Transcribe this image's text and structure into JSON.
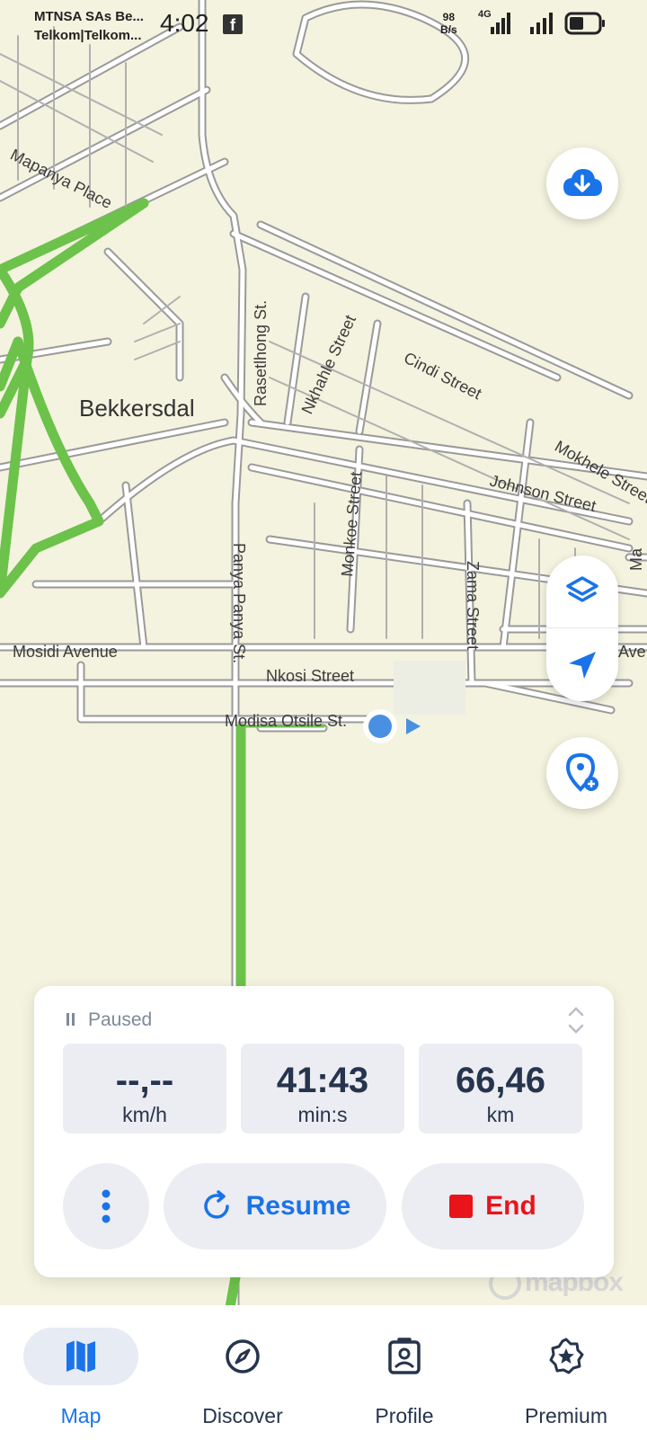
{
  "status_bar": {
    "carrier_line1": "MTNSA SAs Be...",
    "carrier_line2": "Telkom|Telkom...",
    "time": "4:02",
    "net_speed_value": "98",
    "net_speed_unit": "B/s",
    "network_type": "4G",
    "battery_level": 0.5
  },
  "map": {
    "place_labels": {
      "town": "Bekkersdal",
      "street_1": "Mapanya Place",
      "street_2": "Rasetlhong St.",
      "street_3": "Nkhahle Street",
      "street_4": "Cindi Street",
      "street_5": "Mokhele Street",
      "street_6": "Johnson Street",
      "street_7": "Monkoe Street",
      "street_8": "Panya Panya St.",
      "street_9": "Zama Street",
      "street_10": "Mosidi Avenue",
      "street_11": "Ave",
      "street_12": "Nkosi Street",
      "street_13": "Modisa Otsile St.",
      "street_14": "Ma"
    },
    "attribution": "mapbox",
    "colors": {
      "background": "#f4f3df",
      "route": "#6cc24a",
      "road_outline": "#9a9a9a",
      "location": "#4a90e2"
    },
    "controls": {
      "download_icon": "cloud-download-icon",
      "layers_icon": "layers-icon",
      "locate_icon": "navigation-arrow-icon",
      "add_poi_icon": "location-pin-add-icon"
    }
  },
  "recording_card": {
    "state": "Paused",
    "stats": [
      {
        "value": "--,--",
        "unit": "km/h"
      },
      {
        "value": "41:43",
        "unit": "min:s"
      },
      {
        "value": "66,46",
        "unit": "km"
      }
    ],
    "more_icon": "more-vertical-icon",
    "resume_label": "Resume",
    "end_label": "End",
    "colors": {
      "accent": "#1a73e8",
      "end": "#e8141a"
    }
  },
  "bottom_nav": {
    "items": [
      {
        "label": "Map",
        "icon": "map-icon",
        "active": true
      },
      {
        "label": "Discover",
        "icon": "compass-icon",
        "active": false
      },
      {
        "label": "Profile",
        "icon": "profile-badge-icon",
        "active": false
      },
      {
        "label": "Premium",
        "icon": "star-badge-icon",
        "active": false
      }
    ]
  }
}
